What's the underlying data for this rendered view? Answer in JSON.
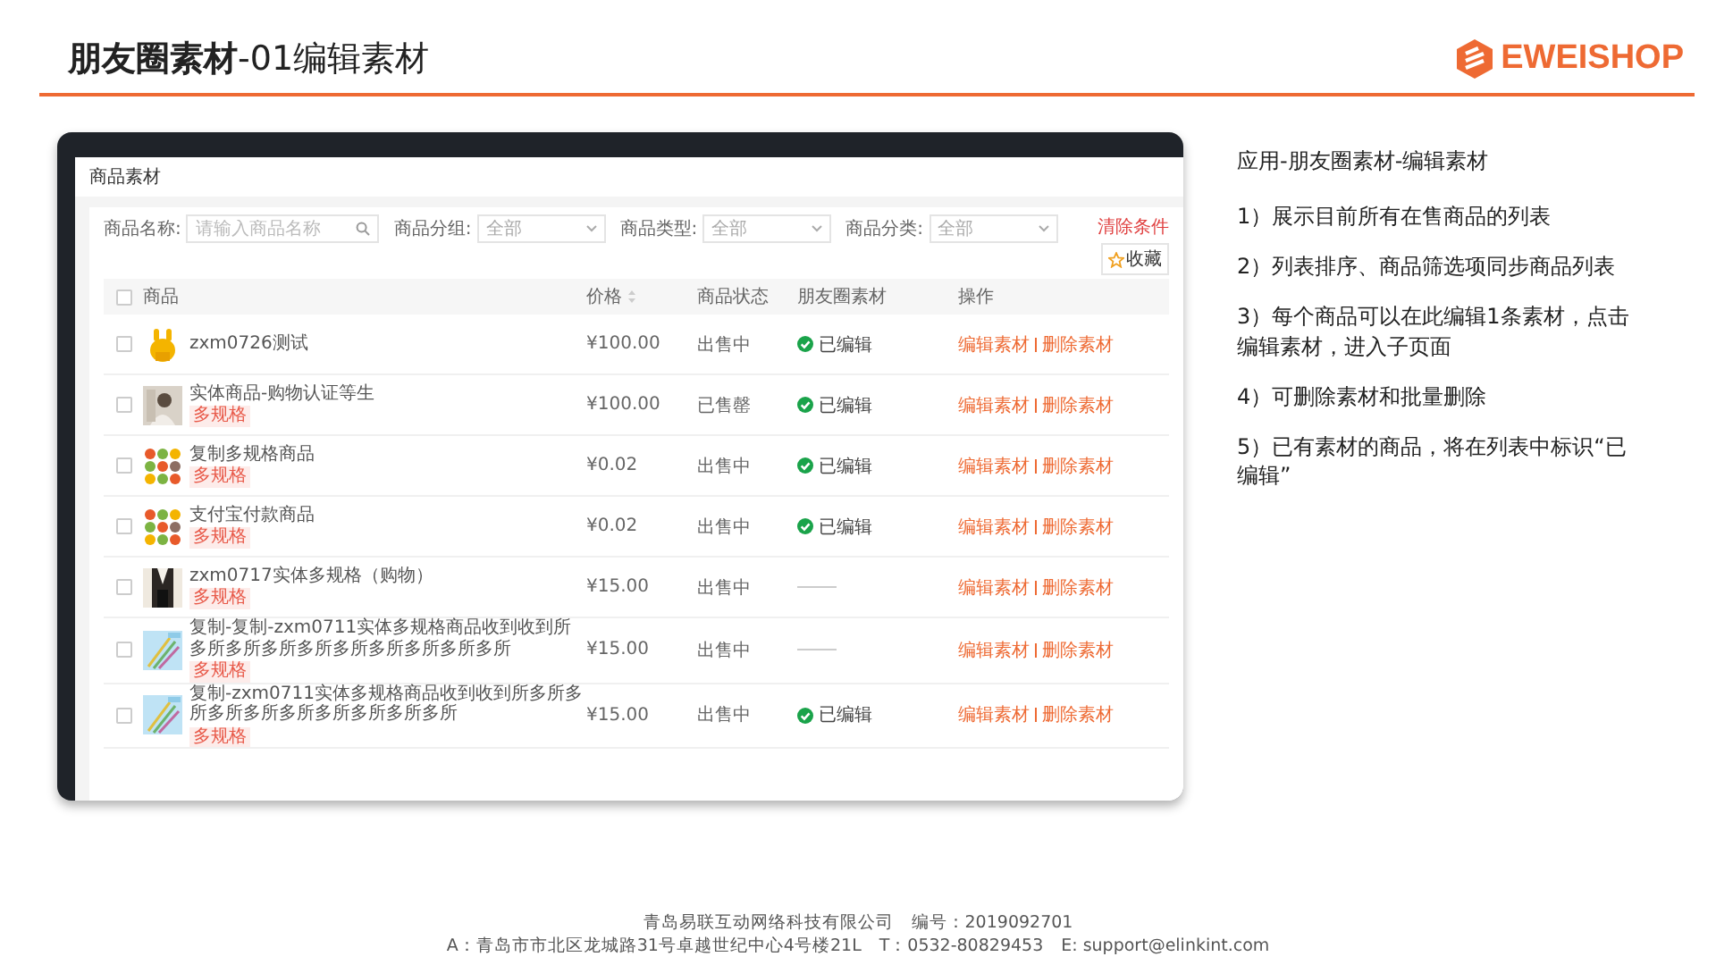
{
  "slide_title": "**朋友圈素材**-01编辑素材",
  "logo": {
    "text": "EWEISHOP"
  },
  "screen": {
    "page_title": "商品素材",
    "filters": [
      {
        "label": "商品名称:",
        "kind": "search",
        "placeholder": "请输入商品名称"
      },
      {
        "label": "商品分组:",
        "kind": "select",
        "value": "全部"
      },
      {
        "label": "商品类型:",
        "kind": "select",
        "value": "全部"
      },
      {
        "label": "商品分类:",
        "kind": "select",
        "value": "全部"
      }
    ],
    "clear_link": "清除条件",
    "favorite_button": "收藏",
    "header_checkbox": {
      "checked": false
    },
    "columns": [
      "商品",
      "价格",
      "商品状态",
      "朋友圈素材",
      "操作"
    ],
    "rows": [
      {
        "checked": false,
        "name": "zxm0726测试",
        "tag": null,
        "price": "¥100.00",
        "status": "出售中",
        "edited": true,
        "edited_label": "已编辑",
        "actions": [
          "编辑素材",
          "删除素材"
        ]
      },
      {
        "checked": false,
        "name": "实体商品-购物认证等生",
        "tag": "多规格",
        "price": "¥100.00",
        "status": "已售罄",
        "edited": true,
        "edited_label": "已编辑",
        "actions": [
          "编辑素材",
          "删除素材"
        ]
      },
      {
        "checked": false,
        "name": "复制多规格商品",
        "tag": "多规格",
        "price": "¥0.02",
        "status": "出售中",
        "edited": true,
        "edited_label": "已编辑",
        "actions": [
          "编辑素材",
          "删除素材"
        ]
      },
      {
        "checked": false,
        "name": "支付宝付款商品",
        "tag": "多规格",
        "price": "¥0.02",
        "status": "出售中",
        "edited": true,
        "edited_label": "已编辑",
        "actions": [
          "编辑素材",
          "删除素材"
        ]
      },
      {
        "checked": false,
        "name": "zxm0717实体多规格（购物）",
        "tag": "多规格",
        "price": "¥15.00",
        "status": "出售中",
        "edited": false,
        "edited_label": null,
        "actions": [
          "编辑素材",
          "删除素材"
        ]
      },
      {
        "checked": false,
        "name": "复制-复制-zxm0711实体多规格商品收到收到所多所多所多所多所多所多所多所多所多所",
        "tag": "多规格",
        "price": "¥15.00",
        "status": "出售中",
        "edited": false,
        "edited_label": null,
        "actions": [
          "编辑素材",
          "删除素材"
        ]
      },
      {
        "checked": false,
        "name": "复制-zxm0711实体多规格商品收到收到所多所多所多所多所多所多所多所多所多所",
        "tag": "多规格",
        "price": "¥15.00",
        "status": "出售中",
        "edited": true,
        "edited_label": "已编辑",
        "actions": [
          "编辑素材",
          "删除素材"
        ]
      }
    ]
  },
  "notes": {
    "heading": "应用-朋友圈素材-编辑素材",
    "items": [
      "1）展示目前所有在售商品的列表",
      "2）列表排序、商品筛选项同步商品列表",
      "3）每个商品可以在此编辑1条素材，点击编辑素材，进入子页面",
      "4）可删除素材和批量删除",
      "5）已有素材的商品，将在列表中标识“已编辑”"
    ]
  },
  "footer": [
    "青岛易联互动网络科技有限公司　编号：2019092701",
    "A：青岛市市北区龙城路31号卓越世纪中心4号楼21L　T：0532-80829453　E: support@elinkint.com"
  ]
}
